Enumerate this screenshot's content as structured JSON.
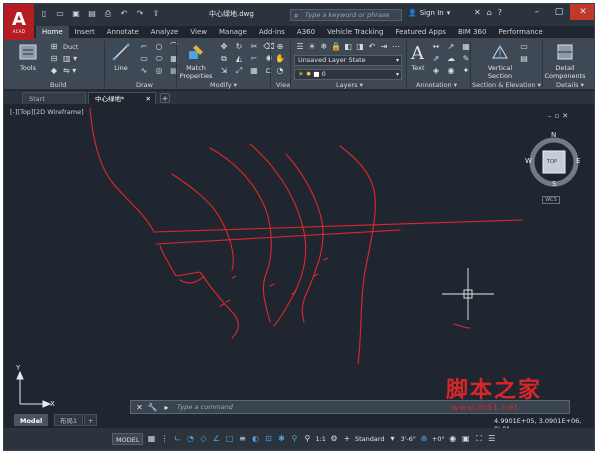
{
  "app": {
    "logo_letter": "A",
    "logo_sub": "ACAD",
    "doc_title": "中心绿地.dwg"
  },
  "titlebar": {
    "search_placeholder": "Type a keyword or phrase",
    "signin_label": "Sign In"
  },
  "ribbon_tabs": [
    "Home",
    "Insert",
    "Annotate",
    "Analyze",
    "View",
    "Manage",
    "Add-ins",
    "A360",
    "Vehicle Tracking",
    "Featured Apps",
    "BIM 360",
    "Performance"
  ],
  "ribbon": {
    "tools_label": "Tools",
    "duct_label": "Duct",
    "build_label": "Build",
    "line_label": "Line",
    "draw_label": "Draw",
    "match_label": "Match Properties",
    "modify_label": "Modify",
    "view_label": "View",
    "layer_state": "Unsaved Layer State",
    "layer_current": "0",
    "layers_label": "Layers",
    "text_label": "Text",
    "annotation_label": "Annotation",
    "vertical_section_label": "Vertical Section",
    "section_elevation_label": "Section & Elevation",
    "detail_components_label": "Detail Components",
    "details_label": "Details"
  },
  "doc_tabs": [
    {
      "label": "Start"
    },
    {
      "label": "中心绿地*"
    }
  ],
  "viewport_label": "[-][Top][2D Wireframe]",
  "viewcube": {
    "top": "TOP",
    "n": "N",
    "s": "S",
    "e": "E",
    "w": "W",
    "wcs": "WCS"
  },
  "command": {
    "placeholder": "Type a command"
  },
  "coords": "4.9901E+05, 3.0901E+06, 0'-0\"",
  "layout_tabs": [
    "Model",
    "布局1"
  ],
  "status": {
    "mode": "MODEL",
    "scale": "1:1",
    "standard": "Standard",
    "dim": "3'-6\"",
    "angle": "+0°"
  },
  "watermark": {
    "line1": "脚本之家",
    "line2": "www.jb51.net"
  },
  "colors": {
    "drawing_red": "#e0262b",
    "background": "#1f2630",
    "ribbon": "#3f4855"
  }
}
